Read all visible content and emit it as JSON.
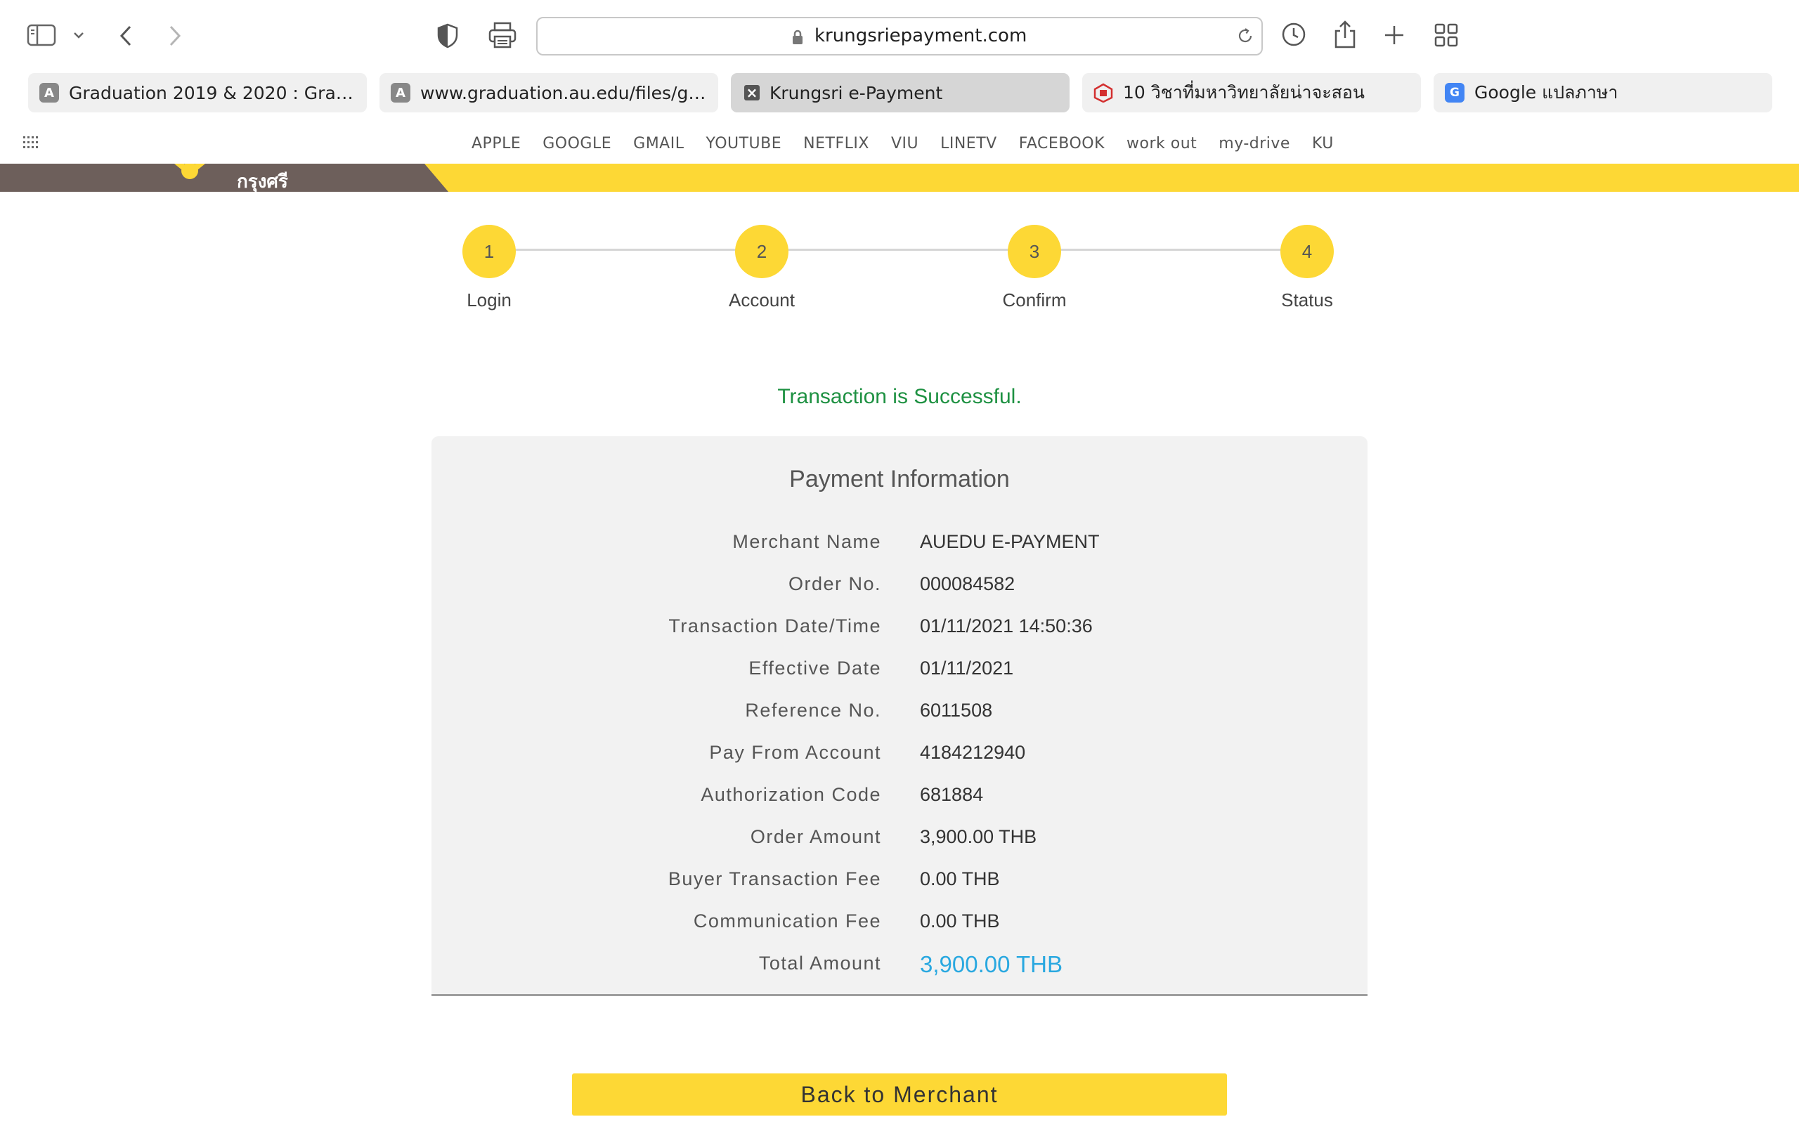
{
  "browser": {
    "url": "krungsriepayment.com",
    "tabs": [
      {
        "label": "Graduation 2019 & 2020 : Gradua...",
        "favicon_icon": "letter-a-icon",
        "favicon_text": "A",
        "favicon_color": "#888888",
        "active": false
      },
      {
        "label": "www.graduation.au.edu/files/grad...",
        "favicon_icon": "letter-a-icon",
        "favicon_text": "A",
        "favicon_color": "#888888",
        "active": false
      },
      {
        "label": "Krungsri e-Payment",
        "favicon_icon": "close-icon",
        "favicon_text": "×",
        "favicon_color": "#555555",
        "active": true
      },
      {
        "label": "10 วิชาที่มหาวิทยาลัยน่าจะสอน",
        "favicon_icon": "site-logo-icon",
        "favicon_text": "",
        "favicon_color": "#d32f2f",
        "active": false
      },
      {
        "label": "Google แปลภาษา",
        "favicon_icon": "google-translate-icon",
        "favicon_text": "G",
        "favicon_color": "#4285f4",
        "active": false
      }
    ],
    "bookmarks": [
      "APPLE",
      "GOOGLE",
      "GMAIL",
      "YOUTUBE",
      "NETFLIX",
      "VIU",
      "LINETV",
      "FACEBOOK",
      "work out",
      "my-drive",
      "KU"
    ]
  },
  "page": {
    "brand_text": "กรุงศรี",
    "brand_colors": {
      "yellow": "#fdd835",
      "brown": "#6d5f5b"
    },
    "steps": [
      {
        "number": "1",
        "label": "Login"
      },
      {
        "number": "2",
        "label": "Account"
      },
      {
        "number": "3",
        "label": "Confirm"
      },
      {
        "number": "4",
        "label": "Status"
      }
    ],
    "status_message": "Transaction is Successful.",
    "status_color": "#1e9142",
    "payment": {
      "title": "Payment Information",
      "rows": [
        {
          "label": "Merchant Name",
          "value": "AUEDU E-PAYMENT"
        },
        {
          "label": "Order No.",
          "value": "000084582"
        },
        {
          "label": "Transaction Date/Time",
          "value": "01/11/2021 14:50:36"
        },
        {
          "label": "Effective Date",
          "value": "01/11/2021"
        },
        {
          "label": "Reference No.",
          "value": "6011508"
        },
        {
          "label": "Pay From Account",
          "value": "4184212940"
        },
        {
          "label": "Authorization Code",
          "value": "681884"
        },
        {
          "label": "Order Amount",
          "value": "3,900.00 THB"
        },
        {
          "label": "Buyer Transaction Fee",
          "value": "0.00 THB"
        },
        {
          "label": "Communication Fee",
          "value": "0.00 THB"
        },
        {
          "label": "Total Amount",
          "value": "3,900.00 THB"
        }
      ],
      "total_color": "#29a8e0"
    },
    "back_button_label": "Back to Merchant"
  }
}
